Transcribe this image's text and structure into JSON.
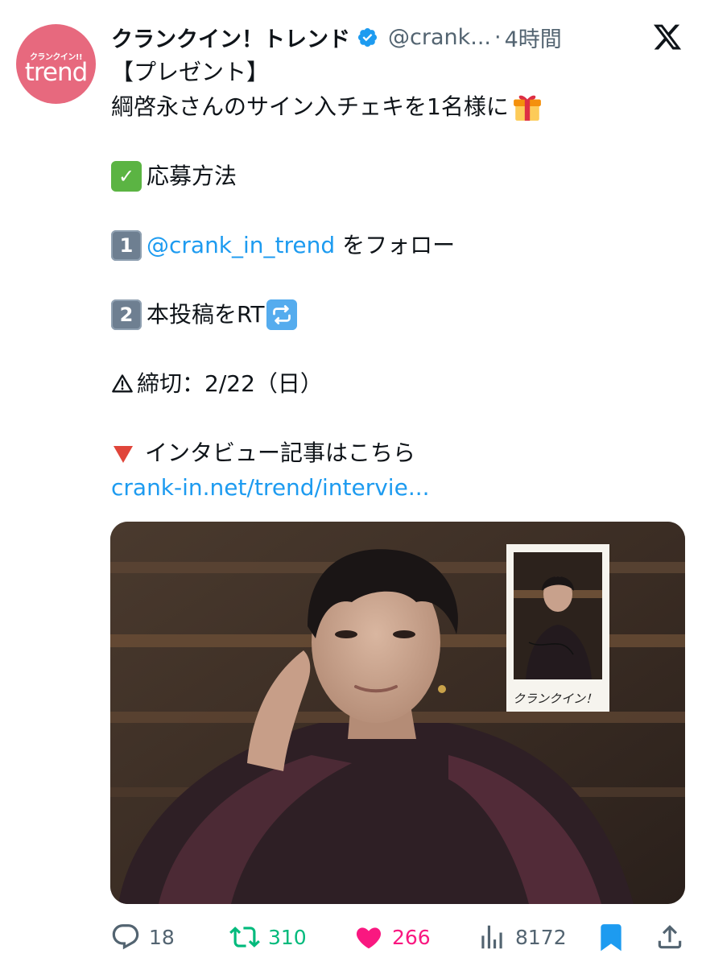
{
  "account": {
    "avatar_logo_top": "クランクイン!!",
    "avatar_logo_main": "trend",
    "display_name": "クランクイン！トレンド",
    "handle": "@crank...",
    "separator": "·",
    "time": "4時間",
    "platform_icon": "x-logo-icon"
  },
  "tweet": {
    "line1": "【プレゼント】",
    "line2": "綱啓永さんのサイン入チェキを1名様に",
    "line3": "応募方法",
    "step1_number": "1",
    "step1_mention": "@crank_in_trend",
    "step1_text": " をフォロー",
    "step2_number": "2",
    "step2_text": "本投稿をRT",
    "deadline": "締切：2/22（日）",
    "article_text": "インタビュー記事はこちら",
    "article_link": "crank-in.net/trend/intervie..."
  },
  "media": {
    "polaroid_caption": "クランクイン！"
  },
  "actions": {
    "replies": "18",
    "retweets": "310",
    "likes": "266",
    "views": "8172"
  },
  "colors": {
    "link": "#1d9bf0",
    "retweet": "#00ba7c",
    "like": "#f91880",
    "bookmark": "#1d9bf0",
    "secondary_text": "#536471",
    "avatar_bg": "#e7697e"
  }
}
